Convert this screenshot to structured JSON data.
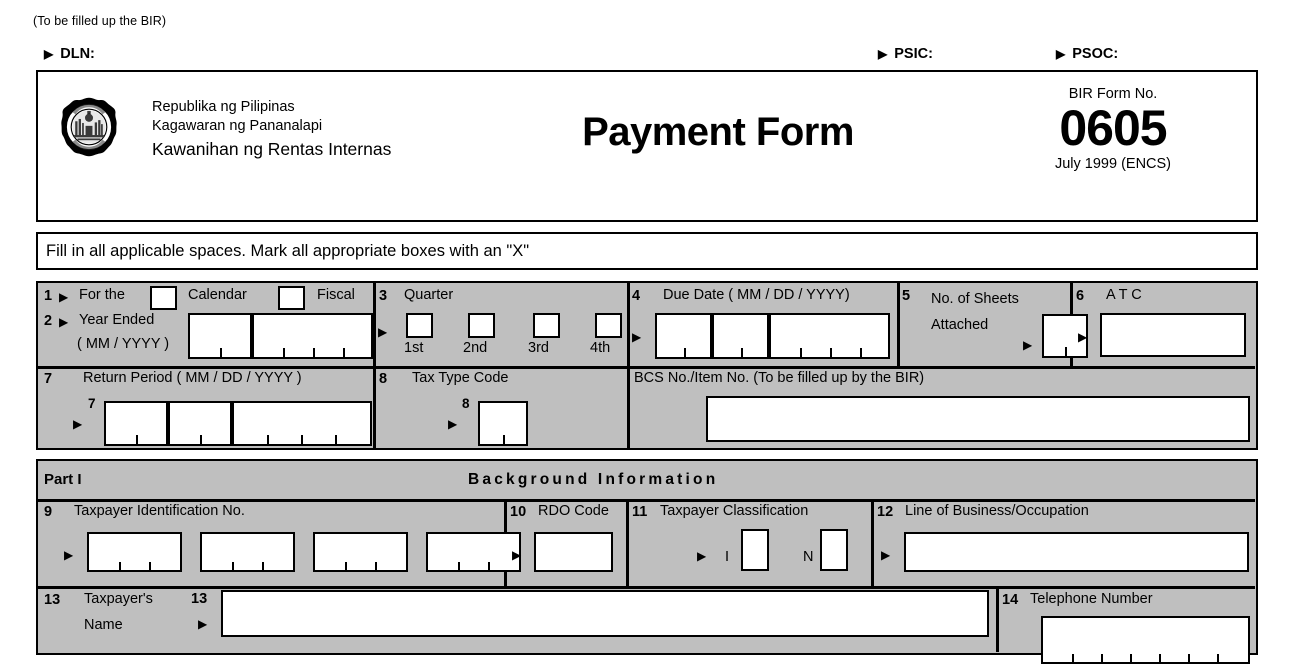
{
  "meta": {
    "top_note": "(To be filled up the BIR)",
    "arrow_glyph": "▶"
  },
  "dln_row": {
    "dln_label": "DLN:",
    "psic_label": "PSIC:",
    "psoc_label": "PSOC:"
  },
  "header": {
    "agency_line1": "Republika ng Pilipinas",
    "agency_line2": "Kagawaran ng Pananalapi",
    "agency_line3": "Kawanihan ng Rentas Internas",
    "form_title": "Payment Form",
    "form_no_caption": "BIR Form No.",
    "form_number": "0605",
    "revision": "July 1999 (ENCS)",
    "seal_name": "bir-seal"
  },
  "instruction": {
    "text": "Fill in all applicable spaces.  Mark all appropriate boxes with an \"X\""
  },
  "items": {
    "i1": {
      "no": "1",
      "label": "For the",
      "option_calendar": "Calendar",
      "option_fiscal": "Fiscal"
    },
    "i2": {
      "no": "2",
      "label": "Year Ended",
      "sublabel": "(  MM / YYYY )"
    },
    "i3": {
      "no": "3",
      "label": "Quarter",
      "q1": "1st",
      "q2": "2nd",
      "q3": "3rd",
      "q4": "4th"
    },
    "i4": {
      "no": "4",
      "label": "Due Date ( MM / DD / YYYY)"
    },
    "i5": {
      "no": "5",
      "label_line1": "No. of Sheets",
      "label_line2": "Attached"
    },
    "i6": {
      "no": "6",
      "label": "A T C"
    },
    "i7": {
      "no": "7",
      "label": "Return Period ( MM / DD / YYYY )",
      "inner_no": "7"
    },
    "i8": {
      "no": "8",
      "label": "Tax Type Code",
      "inner_no": "8"
    },
    "bcs": {
      "label": "BCS No./Item No. (To be filled up by the  BIR)"
    },
    "i9": {
      "no": "9",
      "label": "Taxpayer Identification  No."
    },
    "i10": {
      "no": "10",
      "label": "RDO Code"
    },
    "i11": {
      "no": "11",
      "label": "Taxpayer Classification",
      "opt_i": "I",
      "opt_n": "N"
    },
    "i12": {
      "no": "12",
      "label": "Line of Business/Occupation"
    },
    "i13": {
      "no": "13",
      "label_line1": "Taxpayer's",
      "label_line2": "Name",
      "inner_no": "13"
    },
    "i14": {
      "no": "14",
      "label": "Telephone Number"
    }
  },
  "part1": {
    "part_label": "Part I",
    "title": "Background  Information"
  },
  "colors": {
    "panel_gray": "#bfbfbf",
    "ink": "#000000",
    "field_white": "#ffffff"
  }
}
